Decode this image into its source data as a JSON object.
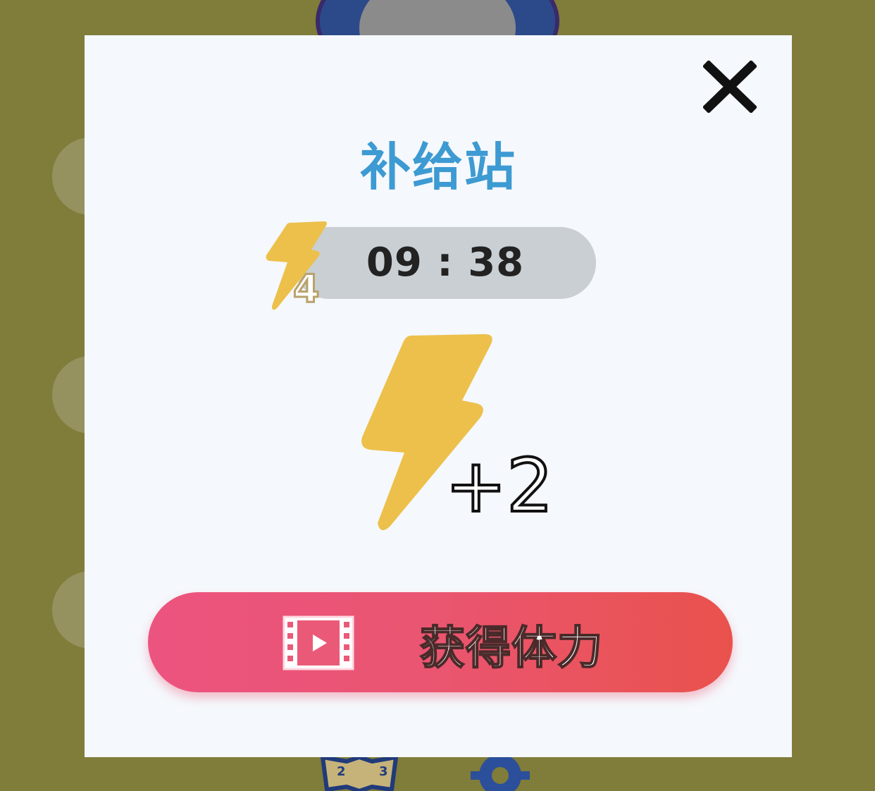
{
  "modal": {
    "title": "补给站",
    "close_icon": "close-icon",
    "timer": "09 : 38",
    "energy_count": "4",
    "reward_amount": "+2",
    "energy_icon": "lightning-bolt-icon",
    "button": {
      "label": "获得体力",
      "icon": "video-play-icon"
    }
  },
  "colors": {
    "backdrop": "#807c3a",
    "modal_bg": "#f5f8fc",
    "title": "#3d9ad2",
    "bolt": "#ecc04a",
    "timer_pill": "#c9cfd3",
    "button_start": "#ec5480",
    "button_end": "#e9524c"
  }
}
